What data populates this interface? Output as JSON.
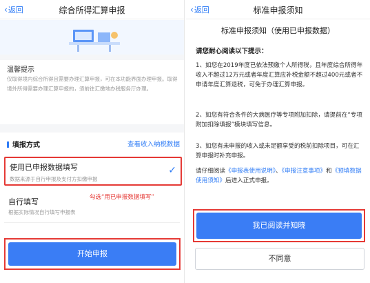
{
  "left": {
    "header": {
      "back_label": "返回",
      "title": "综合所得汇算申报"
    },
    "tips": {
      "title": "温馨提示",
      "body": "仅取得境内综合所得且需要办理汇算申报，可在本功能界面办理申报。取得境外所得需要办理汇算申报的，须前往汇缴地办税服务厅办理。"
    },
    "fill_method": {
      "label": "填报方式",
      "view_link": "查看收入纳税数据",
      "options": [
        {
          "name": "使用已申报数据填写",
          "desc": "数据来源于自行申报及支付方扣缴申报",
          "selected": true
        },
        {
          "name": "自行填写",
          "desc": "根据实际情况自行填写申报表",
          "selected": false
        }
      ],
      "annotation": "勾选“用已申报数据填写”"
    },
    "start_button": "开始申报"
  },
  "right": {
    "header": {
      "back_label": "返回",
      "title": "标准申报须知"
    },
    "heading": "标准申报须知（使用已申报数据）",
    "subheading": "请您耐心阅读以下提示：",
    "paragraphs": [
      "1、如您在2019年度已依法预缴个人所得税，且年度综合所得年收入不超过12万元或者年度汇算应补税金额不超过400元或者不申请年度汇算退税，可免于办理汇算申报。",
      "2、如您有符合条件的大病医疗等专项附加扣除，请提前在“专项附加扣除填报”模块填写信息。",
      "3、如您有未申报的收入或未足额享受的税前扣除项目，可在汇算申报时补充申报。"
    ],
    "notice": {
      "prefix": "请仔细阅读",
      "link1": "《申报表使用说明》",
      "sep1": "、",
      "link2": "《申报注意事项》",
      "sep2": "和",
      "link3": "《预填数据使用须知》",
      "suffix": "后进入正式申报。"
    },
    "confirm_button": "我已阅读并知晓",
    "disagree_button": "不同意"
  },
  "colors": {
    "accent": "#3a7df5",
    "highlight": "#e53935"
  }
}
